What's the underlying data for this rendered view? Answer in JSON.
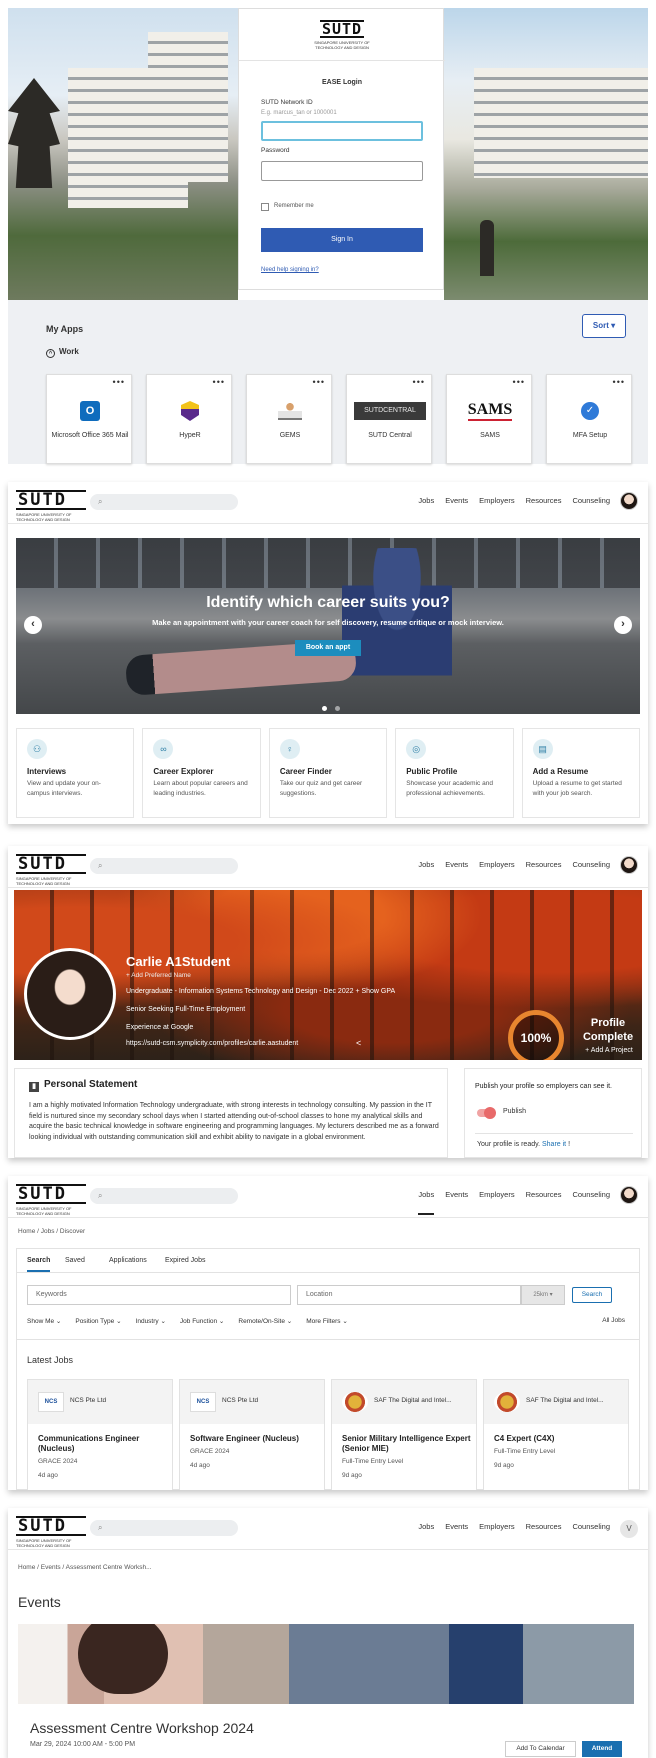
{
  "login": {
    "logo_text": "SUTD",
    "logo_sub": "SINGAPORE UNIVERSITY OF TECHNOLOGY AND DESIGN",
    "title": "EASE Login",
    "network_id_label": "SUTD Network ID",
    "network_id_hint": "E.g. marcus_tan or 1000001",
    "password_label": "Password",
    "remember_label": "Remember me",
    "signin_label": "Sign In",
    "help_link": "Need help signing in?"
  },
  "myapps": {
    "title": "My Apps",
    "sort_label": "Sort ▾",
    "group_label": "Work",
    "apps": [
      {
        "name": "Microsoft Office 365 Mail",
        "icon": "outlook-icon"
      },
      {
        "name": "HypeR",
        "icon": "hyper-icon"
      },
      {
        "name": "GEMS",
        "icon": "gems-icon"
      },
      {
        "name": "SUTD Central",
        "icon": "sutd-central-icon",
        "logo_text": "SUTDCENTRAL"
      },
      {
        "name": "SAMS",
        "icon": "sams-icon",
        "logo_text": "SAMS"
      },
      {
        "name": "MFA Setup",
        "icon": "mfa-icon"
      }
    ]
  },
  "nav": {
    "logo_text": "SUTD",
    "logo_sub": "SINGAPORE UNIVERSITY OF TECHNOLOGY AND DESIGN",
    "links": [
      "Jobs",
      "Events",
      "Employers",
      "Resources",
      "Counseling"
    ],
    "avatar_initial": "V"
  },
  "hero": {
    "title": "Identify which career suits you?",
    "subtitle": "Make an appointment with your career coach for self discovery, resume critique or mock interview.",
    "button": "Book an appt"
  },
  "features": [
    {
      "title": "Interviews",
      "desc": "View and update your on-campus interviews.",
      "icon": "interview-icon"
    },
    {
      "title": "Career Explorer",
      "desc": "Learn about popular careers and leading industries.",
      "icon": "binoculars-icon"
    },
    {
      "title": "Career Finder",
      "desc": "Take our quiz and get career suggestions.",
      "icon": "lightbulb-icon"
    },
    {
      "title": "Public Profile",
      "desc": "Showcase your academic and professional achievements.",
      "icon": "globe-icon"
    },
    {
      "title": "Add a Resume",
      "desc": "Upload a resume to get started with your job search.",
      "icon": "document-icon"
    }
  ],
  "profile": {
    "name": "Carlie A1Student",
    "add_preferred": "+ Add Preferred Name",
    "line1": "Undergraduate - Information Systems Technology and Design - Dec 2022 + Show GPA",
    "line2": "Senior Seeking Full-Time Employment",
    "line3": "Experience at Google",
    "url": "https://sutd-csm.symplicity.com/profiles/carlie.aastudent",
    "completion": "100%",
    "completion_label": "Profile Complete",
    "add_project": "+ Add A Project",
    "statement_title": "Personal Statement",
    "statement": "I am a highly motivated Information Technology undergraduate, with strong interests in technology consulting. My passion in the IT field is nurtured since my secondary school days when I started attending out-of-school classes to hone my analytical skills and acquire the basic technical knowledge in software engineering and programming languages. My lecturers described me as a forward looking individual with outstanding communication skill and exhibit ability to navigate in a global environment.",
    "publish_prompt": "Publish your profile so employers can see it.",
    "publish_label": "Publish",
    "ready_text": "Your profile is ready.",
    "share_link": "Share it",
    "share_tail": "!"
  },
  "jobs": {
    "breadcrumb": "Home / Jobs / Discover",
    "tabs": [
      "Search",
      "Saved",
      "Applications",
      "Expired Jobs"
    ],
    "keywords_placeholder": "Keywords",
    "location_placeholder": "Location",
    "distance": "25km ▾",
    "search_button": "Search",
    "filters": [
      "Show Me ⌄",
      "Position Type ⌄",
      "Industry ⌄",
      "Job Function ⌄",
      "Remote/On-Site ⌄",
      "More Filters ⌄"
    ],
    "all_jobs": "All Jobs",
    "latest_title": "Latest Jobs",
    "list": [
      {
        "company": "NCS Pte Ltd",
        "logo": "NCS",
        "title": "Communications Engineer (Nucleus)",
        "meta1": "GRACE 2024",
        "meta2": "4d ago"
      },
      {
        "company": "NCS Pte Ltd",
        "logo": "NCS",
        "title": "Software Engineer (Nucleus)",
        "meta1": "GRACE 2024",
        "meta2": "4d ago"
      },
      {
        "company": "SAF The Digital and Intel...",
        "logo": "",
        "title": "Senior Military Intelligence Expert (Senior MIE)",
        "meta1": "Full-Time Entry Level",
        "meta2": "9d ago"
      },
      {
        "company": "SAF The Digital and Intel...",
        "logo": "",
        "title": "C4 Expert (C4X)",
        "meta1": "Full-Time Entry Level",
        "meta2": "9d ago"
      }
    ]
  },
  "events": {
    "breadcrumb": "Home / Events / Assessment Centre Worksh...",
    "title": "Events",
    "event_name": "Assessment Centre Workshop 2024",
    "event_date": "Mar 29, 2024 10:00 AM - 5:00 PM",
    "calendar_button": "Add To Calendar",
    "attend_button": "Attend"
  }
}
